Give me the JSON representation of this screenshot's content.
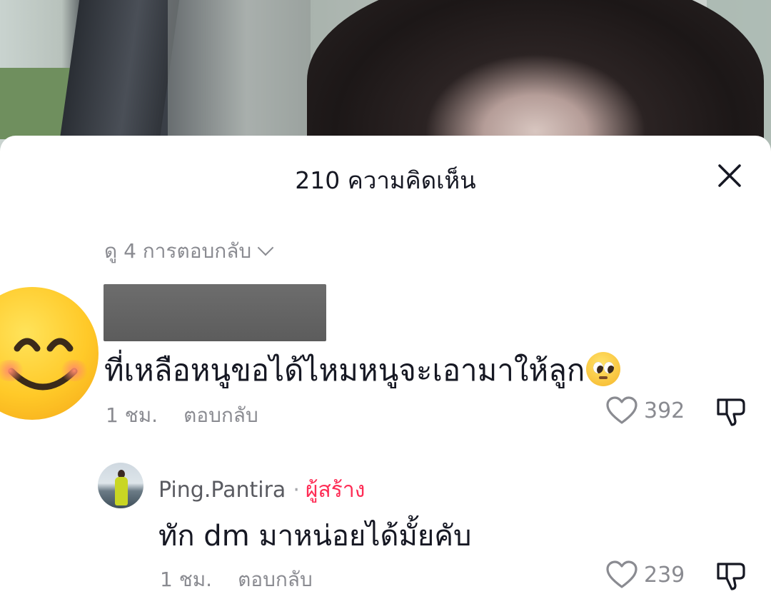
{
  "sheet": {
    "title": "210 ความคิดเห็น",
    "view_replies_label": "ดู 4 การตอบกลับ"
  },
  "comments": [
    {
      "text": "ที่เหลือหนูขอได้ไหมหนูจะเอามาให้ลูก",
      "time": "1 ชม.",
      "reply_label": "ตอบกลับ",
      "likes": "392",
      "avatar_icon": "smiling-face-emoji",
      "trailing_emoji": "pleading-face-emoji"
    },
    {
      "username": "Ping.Pantira",
      "separator": "·",
      "badge": "ผู้สร้าง",
      "text": "ทัก dm มาหน่อยได้มั้ยคับ",
      "time": "1 ชม.",
      "reply_label": "ตอบกลับ",
      "likes": "239"
    }
  ],
  "colors": {
    "creator_badge": "#fe2c55",
    "muted": "#8a8b91",
    "text": "#161823"
  }
}
